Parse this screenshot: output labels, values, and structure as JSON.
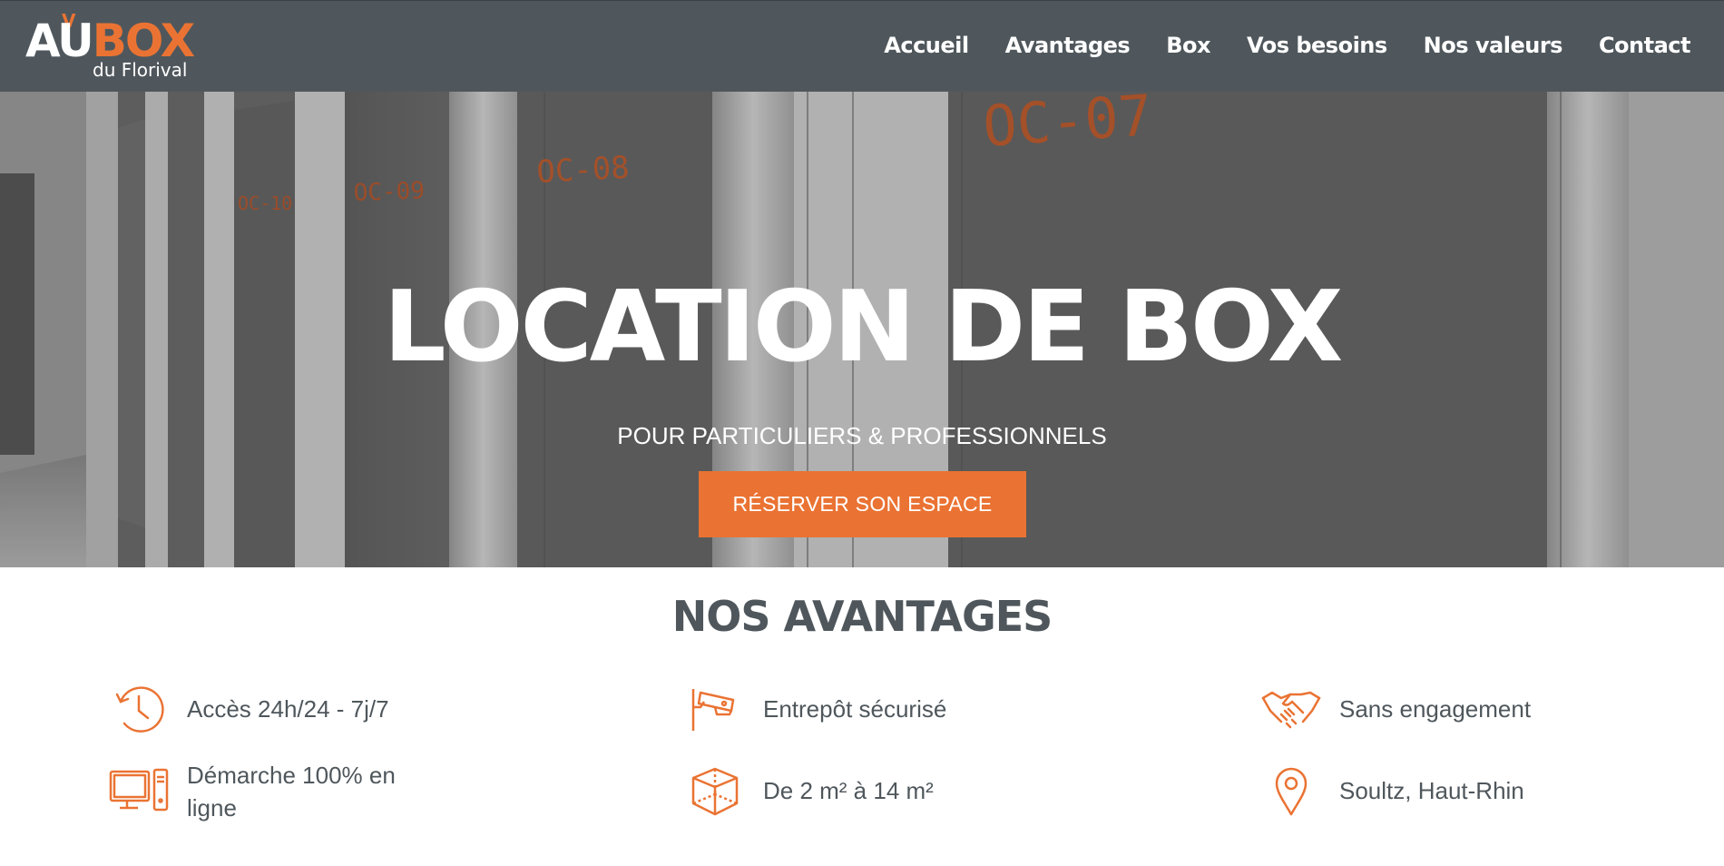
{
  "logo": {
    "au": "AU",
    "box": "BOX",
    "sub": "du Florival"
  },
  "nav": [
    "Accueil",
    "Avantages",
    "Box",
    "Vos besoins",
    "Nos valeurs",
    "Contact"
  ],
  "hero": {
    "title": "LOCATION DE BOX",
    "subtitle": "POUR PARTICULIERS & PROFESSIONNELS",
    "button": "RÉSERVER SON ESPACE",
    "unit_labels": [
      "OC-07",
      "OC-08",
      "OC-09",
      "OC-10"
    ]
  },
  "advantages": {
    "title": "NOS AVANTAGES",
    "items": [
      {
        "icon": "clock-history-icon",
        "text": "Accès 24h/24 - 7j/7"
      },
      {
        "icon": "security-camera-icon",
        "text": "Entrepôt sécurisé"
      },
      {
        "icon": "handshake-icon",
        "text": "Sans engagement"
      },
      {
        "icon": "computer-icon",
        "text": "Démarche 100% en ligne"
      },
      {
        "icon": "cube-icon",
        "text": "De 2 m² à 14 m²"
      },
      {
        "icon": "map-pin-icon",
        "text": "Soultz, Haut-Rhin"
      }
    ]
  },
  "colors": {
    "header": "#4f575c",
    "accent": "#ea7333",
    "text": "#4f575c"
  }
}
